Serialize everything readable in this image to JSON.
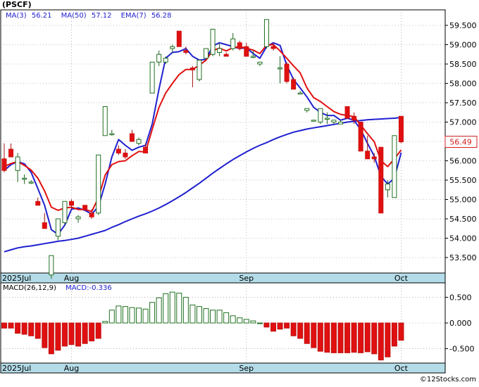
{
  "chart_data": [
    {
      "type": "candlestick",
      "title": "(PSCF)",
      "indicators": [
        {
          "label": "MA(3)",
          "value": "56.21",
          "color": "#2020d0"
        },
        {
          "label": "MA(50)",
          "value": "57.12",
          "color": "#2020d0"
        },
        {
          "label": "EMA(7)",
          "value": "56.28",
          "color": "#2020d0"
        }
      ],
      "last_price_label": "56.49",
      "ylim": [
        53.1,
        59.9
      ],
      "y_ticks": [
        "53.500",
        "54.000",
        "54.500",
        "55.000",
        "55.500",
        "56.000",
        "56.500",
        "57.000",
        "57.500",
        "58.000",
        "58.500",
        "59.000",
        "59.500"
      ],
      "y_tick_values": [
        53.5,
        54.0,
        54.5,
        55.0,
        55.5,
        56.0,
        56.5,
        57.0,
        57.5,
        58.0,
        58.5,
        59.0,
        59.5
      ],
      "x_month_labels": [
        {
          "index": 0,
          "label": "2025Jul"
        },
        {
          "index": 10,
          "label": "Aug"
        },
        {
          "index": 36,
          "label": "Sep"
        },
        {
          "index": 59,
          "label": "Oct"
        }
      ],
      "candles": [
        [
          56.05,
          56.45,
          55.7,
          55.75
        ],
        [
          56.3,
          56.45,
          56.1,
          56.1
        ],
        [
          55.75,
          56.2,
          55.45,
          56.1
        ],
        [
          55.55,
          55.65,
          55.4,
          55.55
        ],
        [
          55.45,
          55.5,
          55.4,
          55.45
        ],
        [
          54.95,
          55.05,
          54.85,
          54.85
        ],
        [
          54.4,
          54.65,
          54.25,
          54.25
        ],
        [
          53.05,
          53.55,
          52.95,
          53.55
        ],
        [
          54.05,
          54.5,
          53.95,
          54.5
        ],
        [
          54.4,
          54.95,
          54.35,
          54.95
        ],
        [
          54.95,
          55.0,
          54.75,
          54.85
        ],
        [
          54.5,
          54.6,
          54.4,
          54.55
        ],
        [
          54.85,
          54.85,
          54.75,
          54.75
        ],
        [
          54.65,
          54.75,
          54.5,
          54.55
        ],
        [
          54.65,
          56.15,
          54.6,
          56.15
        ],
        [
          56.65,
          57.4,
          56.65,
          57.4
        ],
        [
          56.7,
          56.8,
          56.65,
          56.7
        ],
        [
          56.3,
          56.4,
          56.15,
          56.2
        ],
        [
          56.2,
          56.3,
          56.05,
          56.1
        ],
        [
          56.7,
          56.8,
          56.5,
          56.5
        ],
        [
          56.45,
          56.6,
          56.4,
          56.55
        ],
        [
          56.35,
          56.45,
          56.2,
          56.2
        ],
        [
          57.75,
          58.55,
          57.75,
          58.55
        ],
        [
          58.55,
          58.85,
          58.45,
          58.75
        ],
        [
          58.55,
          58.7,
          58.5,
          58.65
        ],
        [
          58.9,
          59.0,
          58.8,
          58.95
        ],
        [
          59.35,
          59.35,
          58.95,
          58.95
        ],
        [
          58.85,
          58.95,
          58.75,
          58.8
        ],
        [
          58.4,
          58.45,
          57.9,
          58.35
        ],
        [
          58.1,
          58.6,
          58.05,
          58.6
        ],
        [
          58.65,
          58.9,
          58.65,
          58.9
        ],
        [
          58.75,
          59.4,
          58.7,
          59.4
        ],
        [
          58.8,
          59.05,
          58.7,
          58.9
        ],
        [
          58.75,
          58.8,
          58.7,
          58.7
        ],
        [
          58.9,
          59.3,
          58.85,
          59.15
        ],
        [
          59.05,
          59.1,
          58.85,
          58.9
        ],
        [
          58.95,
          59.05,
          58.7,
          58.7
        ],
        [
          58.7,
          58.85,
          58.65,
          58.7
        ],
        [
          58.5,
          58.55,
          58.45,
          58.55
        ],
        [
          58.95,
          59.65,
          58.9,
          59.65
        ],
        [
          58.95,
          59.05,
          58.85,
          58.9
        ],
        [
          58.4,
          58.7,
          58.0,
          58.4
        ],
        [
          58.5,
          58.55,
          58.0,
          58.05
        ],
        [
          58.1,
          58.15,
          57.85,
          57.85
        ],
        [
          57.75,
          57.8,
          57.75,
          57.75
        ],
        [
          57.3,
          57.35,
          57.25,
          57.35
        ],
        [
          57.05,
          57.05,
          57.05,
          57.05
        ],
        [
          57.0,
          57.35,
          56.95,
          57.35
        ],
        [
          57.1,
          57.25,
          56.95,
          57.1
        ],
        [
          57.0,
          57.05,
          56.95,
          57.05
        ],
        [
          56.95,
          57.05,
          56.95,
          57.0
        ],
        [
          57.4,
          57.4,
          57.1,
          57.1
        ],
        [
          57.15,
          57.25,
          56.95,
          57.05
        ],
        [
          57.0,
          57.0,
          56.25,
          56.25
        ],
        [
          56.25,
          56.65,
          56.05,
          56.05
        ],
        [
          56.1,
          56.2,
          55.95,
          56.05
        ],
        [
          56.35,
          56.35,
          54.65,
          54.65
        ],
        [
          55.25,
          55.5,
          55.05,
          55.4
        ],
        [
          55.05,
          56.65,
          55.05,
          56.65
        ],
        [
          57.15,
          57.15,
          56.45,
          56.49
        ]
      ],
      "ma_lines": [
        {
          "name": "MA(50)",
          "color": "#2020d0",
          "values": [
            53.65,
            53.7,
            53.75,
            53.78,
            53.8,
            53.83,
            53.86,
            53.89,
            53.92,
            53.94,
            53.97,
            54.0,
            54.05,
            54.1,
            54.15,
            54.2,
            54.28,
            54.35,
            54.43,
            54.5,
            54.57,
            54.63,
            54.7,
            54.78,
            54.87,
            54.97,
            55.07,
            55.18,
            55.3,
            55.42,
            55.55,
            55.68,
            55.8,
            55.92,
            56.03,
            56.13,
            56.23,
            56.32,
            56.4,
            56.47,
            56.55,
            56.62,
            56.68,
            56.74,
            56.78,
            56.82,
            56.85,
            56.88,
            56.91,
            56.94,
            56.97,
            57.0,
            57.02,
            57.04,
            57.06,
            57.07,
            57.08,
            57.09,
            57.1,
            57.12
          ]
        },
        {
          "name": "MA(3)",
          "color": "#2020d0",
          "values": [
            55.75,
            55.9,
            55.98,
            55.92,
            55.7,
            55.28,
            54.85,
            54.22,
            54.1,
            54.34,
            54.75,
            54.78,
            54.72,
            54.62,
            54.82,
            55.4,
            56.1,
            56.55,
            56.4,
            56.27,
            56.35,
            56.4,
            56.95,
            57.85,
            58.65,
            58.8,
            58.82,
            58.9,
            58.7,
            58.6,
            58.62,
            58.97,
            59.05,
            59.0,
            58.95,
            58.9,
            58.92,
            58.77,
            58.65,
            58.95,
            59.05,
            58.98,
            58.47,
            58.1,
            57.88,
            57.65,
            57.38,
            57.25,
            57.17,
            57.17,
            57.05,
            57.1,
            57.05,
            56.8,
            56.45,
            56.12,
            55.6,
            55.4,
            55.55,
            56.21
          ]
        },
        {
          "name": "EMA(7)",
          "color": "#e01010",
          "values": [
            55.85,
            55.93,
            55.98,
            55.88,
            55.76,
            55.55,
            55.22,
            54.8,
            54.72,
            54.78,
            54.8,
            54.74,
            54.74,
            54.69,
            55.04,
            55.63,
            55.9,
            55.98,
            56.0,
            56.13,
            56.24,
            56.23,
            56.81,
            57.38,
            57.75,
            58.0,
            58.23,
            58.36,
            58.36,
            58.47,
            58.6,
            58.85,
            58.91,
            58.84,
            58.92,
            58.95,
            58.91,
            58.86,
            58.77,
            58.99,
            59.0,
            58.84,
            58.65,
            58.45,
            58.27,
            57.88,
            57.63,
            57.53,
            57.4,
            57.27,
            57.2,
            57.17,
            57.14,
            56.92,
            56.7,
            56.49,
            56.0,
            55.85,
            56.05,
            56.28
          ]
        }
      ]
    },
    {
      "type": "bar",
      "title": "MACD(26,12,9)",
      "macd_label": "MACD:-0.336",
      "ylim": [
        -0.78,
        0.78
      ],
      "y_ticks": [
        "0.500",
        "0.000",
        "-0.500"
      ],
      "y_tick_values": [
        0.5,
        0.0,
        -0.5
      ],
      "values": [
        -0.1,
        -0.1,
        -0.2,
        -0.22,
        -0.25,
        -0.3,
        -0.48,
        -0.6,
        -0.53,
        -0.45,
        -0.42,
        -0.45,
        -0.4,
        -0.35,
        -0.3,
        0.03,
        0.25,
        0.33,
        0.32,
        0.3,
        0.29,
        0.27,
        0.4,
        0.49,
        0.57,
        0.6,
        0.58,
        0.5,
        0.35,
        0.32,
        0.28,
        0.25,
        0.25,
        0.2,
        0.14,
        0.1,
        0.07,
        0.04,
        0.0,
        -0.08,
        -0.16,
        -0.12,
        -0.1,
        -0.25,
        -0.3,
        -0.4,
        -0.48,
        -0.55,
        -0.57,
        -0.58,
        -0.58,
        -0.58,
        -0.57,
        -0.58,
        -0.56,
        -0.6,
        -0.72,
        -0.66,
        -0.45,
        -0.336
      ]
    }
  ],
  "watermark": "©12Stocks.com"
}
